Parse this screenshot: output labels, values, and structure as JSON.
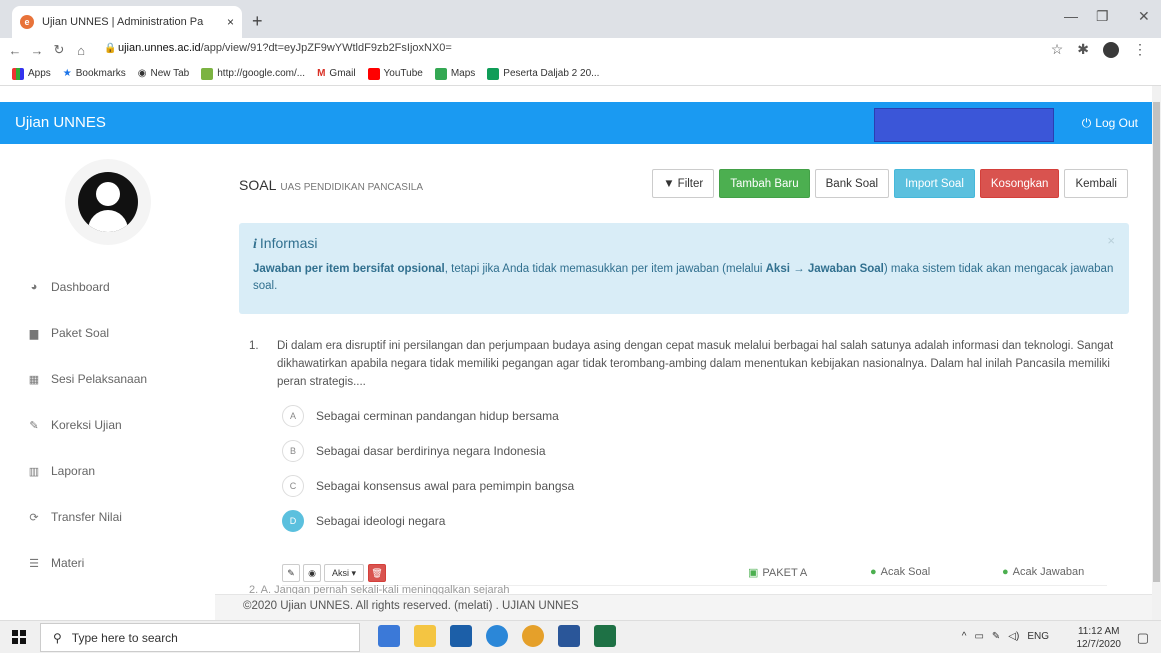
{
  "browser": {
    "tab_title": "Ujian UNNES | Administration Pa",
    "tab_close": "×",
    "new_tab": "+",
    "url_host": "ujian.unnes.ac.id",
    "url_path": "/app/view/91?dt=eyJpZF9wYWtldF9zb2FsIjoxNX0=",
    "bookmarks": [
      "Apps",
      "Bookmarks",
      "New Tab",
      "http://google.com/...",
      "Gmail",
      "YouTube",
      "Maps",
      "Peserta Daljab 2 20..."
    ]
  },
  "header": {
    "brand": "Ujian UNNES",
    "logout": "Log Out",
    "user_box_color": "#3b56d8",
    "bar_color": "#1a9af2"
  },
  "sidebar": {
    "items": [
      {
        "label": "Dashboard",
        "icon": "dashboard-icon"
      },
      {
        "label": "Paket Soal",
        "icon": "box-icon"
      },
      {
        "label": "Sesi Pelaksanaan",
        "icon": "calendar-icon"
      },
      {
        "label": "Koreksi Ujian",
        "icon": "edit-icon"
      },
      {
        "label": "Laporan",
        "icon": "chart-icon"
      },
      {
        "label": "Transfer Nilai",
        "icon": "refresh-icon"
      },
      {
        "label": "Materi",
        "icon": "database-icon"
      }
    ]
  },
  "page": {
    "title": "SOAL",
    "subtitle": "UAS PENDIDIKAN PANCASILA",
    "buttons": {
      "filter": "Filter",
      "tambah": "Tambah Baru",
      "bank": "Bank Soal",
      "import": "Import Soal",
      "kosongkan": "Kosongkan",
      "kembali": "Kembali"
    }
  },
  "info": {
    "title": "Informasi",
    "bold_lead": "Jawaban per item bersifat opsional",
    "text_1": ", tetapi jika Anda tidak memasukkan per item jawaban (melalui ",
    "aksi": "Aksi",
    "arrow": " → ",
    "jawaban_soal": "Jawaban Soal",
    "text_2": ") maka sistem tidak akan mengacak jawaban soal.",
    "close": "×"
  },
  "question": {
    "number": "1.",
    "text": "Di dalam era disruptif ini persilangan dan perjumpaan budaya asing dengan cepat masuk melalui berbagai hal salah satunya adalah informasi dan teknologi. Sangat dikhawatirkan apabila negara tidak memiliki pegangan agar tidak terombang-ambing dalam menentukan kebijakan nasionalnya. Dalam hal inilah Pancasila memiliki peran strategis....",
    "options": [
      {
        "letter": "A",
        "text": "Sebagai cerminan pandangan hidup bersama"
      },
      {
        "letter": "B",
        "text": "Sebagai dasar berdirinya negara Indonesia"
      },
      {
        "letter": "C",
        "text": "Sebagai konsensus awal para pemimpin bangsa"
      },
      {
        "letter": "D",
        "text": "Sebagai ideologi negara"
      }
    ],
    "selected": "D",
    "aksi_label": "Aksi",
    "paket": "PAKET A",
    "acak_soal": "Acak Soal",
    "acak_jawaban": "Acak Jawaban"
  },
  "question2_partial": "2.   A. Jangan pernah sekali-kali meninggalkan sejarah",
  "footer": "©2020 Ujian UNNES. All rights reserved. (melati) . UJIAN UNNES",
  "taskbar": {
    "search_placeholder": "Type here to search",
    "lang": "ENG",
    "time": "11:12 AM",
    "date": "12/7/2020"
  }
}
